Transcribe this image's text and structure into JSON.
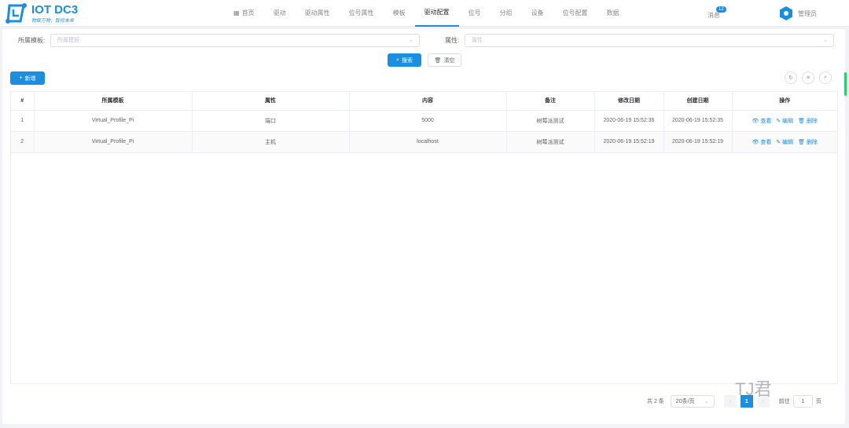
{
  "app": {
    "title": "IOT DC3",
    "slogan": "物联万物，智控未来"
  },
  "nav": {
    "items": [
      {
        "label": "首页",
        "icon": "grid-icon"
      },
      {
        "label": "驱动"
      },
      {
        "label": "驱动属性"
      },
      {
        "label": "位号属性"
      },
      {
        "label": "模板"
      },
      {
        "label": "驱动配置",
        "active": true
      },
      {
        "label": "位号"
      },
      {
        "label": "分组"
      },
      {
        "label": "设备"
      },
      {
        "label": "位号配置"
      },
      {
        "label": "数据"
      }
    ]
  },
  "header": {
    "messages_label": "消息",
    "messages_count": "12",
    "user": "管理员"
  },
  "filters": {
    "profile_label": "所属模板:",
    "profile_placeholder": "所属模板",
    "attr_label": "属性:",
    "attr_placeholder": "属性",
    "search": "搜索",
    "clear": "清空"
  },
  "toolbar": {
    "add": "新增"
  },
  "table": {
    "headers": [
      "#",
      "所属模板",
      "属性",
      "内容",
      "备注",
      "修改日期",
      "创建日期",
      "操作"
    ],
    "rows": [
      {
        "idx": "1",
        "profile": "Virtual_Profile_Pi",
        "attr": "端口",
        "value": "5000",
        "note": "树莓派测试",
        "updated": "2020-06-19 15:52:35",
        "created": "2020-06-19 15:52:35"
      },
      {
        "idx": "2",
        "profile": "Virtual_Profile_Pi",
        "attr": "主机",
        "value": "localhost",
        "note": "树莓派测试",
        "updated": "2020-06-19 15:52:19",
        "created": "2020-06-19 15:52:19"
      }
    ],
    "actions": {
      "view": "查看",
      "edit": "编辑",
      "delete": "删除"
    }
  },
  "pagination": {
    "total": "共 2 条",
    "page_size": "20条/页",
    "current": "1",
    "goto_label": "前往",
    "goto_value": "1",
    "page_suffix": "页"
  },
  "watermark": "TJ君",
  "colors": {
    "primary": "#1a8ee0"
  }
}
